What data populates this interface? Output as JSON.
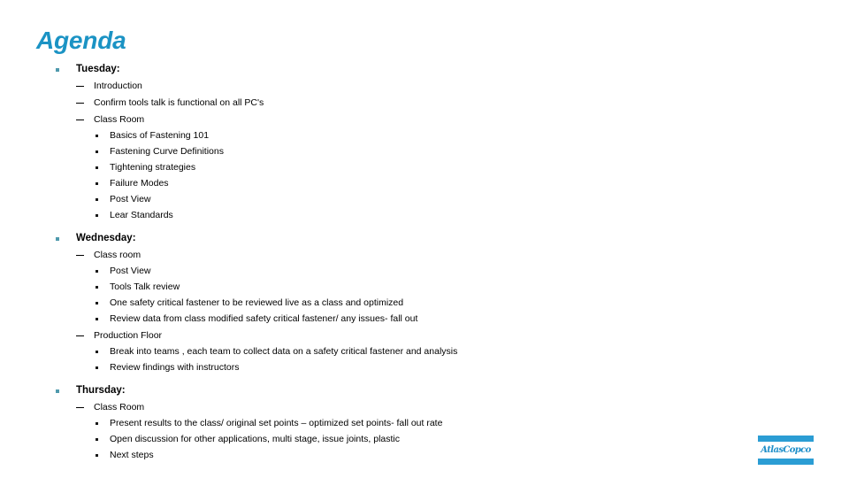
{
  "slide": {
    "title": "Agenda",
    "title_color": "#1b93c4",
    "background_color": "#ffffff"
  },
  "outline": {
    "groups": [
      {
        "heading": "Tuesday:",
        "items": [
          {
            "label": "Introduction",
            "children": []
          },
          {
            "label": "Confirm tools talk is functional on all PC's",
            "children": []
          },
          {
            "label": "Class Room",
            "children": [
              " Basics of Fastening 101",
              "Fastening Curve Definitions",
              "Tightening strategies",
              "Failure Modes",
              "Post View",
              "Lear Standards"
            ]
          }
        ]
      },
      {
        "heading": "Wednesday:",
        "items": [
          {
            "label": "Class room",
            "children": [
              "Post View",
              "Tools Talk review",
              "One safety critical fastener to be reviewed live as a class and  optimized",
              "Review data from class modified safety critical fastener/ any issues- fall out"
            ]
          },
          {
            "label": "Production Floor",
            "children": [
              "Break into teams , each team to collect data on a safety critical fastener and analysis",
              "Review findings with instructors"
            ]
          }
        ]
      },
      {
        "heading": "Thursday:",
        "items": [
          {
            "label": "Class Room",
            "children": [
              "Present results to the class/ original set points – optimized set points- fall out rate",
              "Open discussion for other applications, multi stage, issue joints, plastic",
              "Next steps"
            ]
          }
        ]
      }
    ]
  },
  "logo": {
    "name": "atlas-copco-logo",
    "wordmark": "AtlasCopco",
    "bar_color": "#2b9dd4",
    "text_color": "#1f8fc9"
  }
}
